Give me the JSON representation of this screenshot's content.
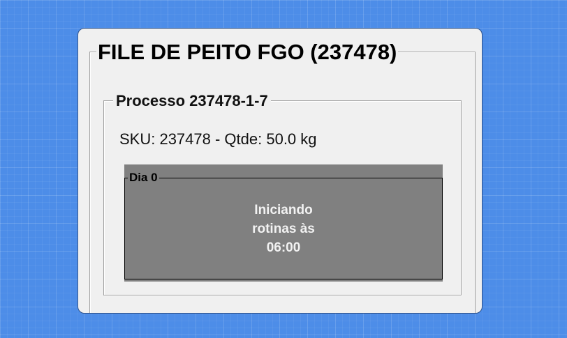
{
  "product": {
    "title": "FILE DE PEITO FGO (237478)"
  },
  "process": {
    "title": "Processo 237478-1-7",
    "sku_line": "SKU: 237478 - Qtde: 50.0 kg"
  },
  "day": {
    "title": "Dia 0",
    "status_lines": [
      "Iniciando",
      "rotinas às",
      "06:00"
    ]
  },
  "colors": {
    "background": "#4d8de8",
    "window": "#f0f0f0",
    "day_panel": "#808080",
    "status_text": "#f2f2f2"
  }
}
